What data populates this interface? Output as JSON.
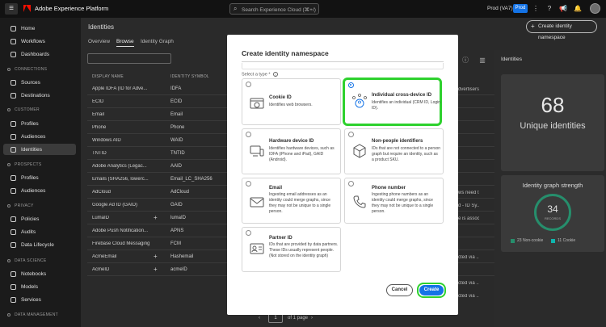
{
  "topbar": {
    "app_title": "Adobe Experience Platform",
    "search_placeholder": "Search Experience Cloud (⌘+/)",
    "org": "Prod (VA7)",
    "env_badge": "Prod"
  },
  "sidebar": {
    "items_top": [
      {
        "label": "Home",
        "icon": "home-icon"
      },
      {
        "label": "Workflows",
        "icon": "workflows-icon"
      },
      {
        "label": "Dashboards",
        "icon": "dashboards-icon"
      }
    ],
    "sections": [
      {
        "title": "CONNECTIONS",
        "items": [
          {
            "label": "Sources"
          },
          {
            "label": "Destinations"
          }
        ]
      },
      {
        "title": "CUSTOMER",
        "items": [
          {
            "label": "Profiles"
          },
          {
            "label": "Audiences"
          },
          {
            "label": "Identities"
          }
        ]
      },
      {
        "title": "PROSPECTS",
        "items": [
          {
            "label": "Profiles"
          },
          {
            "label": "Audiences"
          }
        ]
      },
      {
        "title": "PRIVACY",
        "items": [
          {
            "label": "Policies"
          },
          {
            "label": "Audits"
          },
          {
            "label": "Data Lifecycle"
          }
        ]
      },
      {
        "title": "DATA SCIENCE",
        "items": [
          {
            "label": "Notebooks"
          },
          {
            "label": "Models"
          },
          {
            "label": "Services"
          }
        ]
      },
      {
        "title": "DATA MANAGEMENT",
        "items": []
      }
    ]
  },
  "main": {
    "title": "Identities",
    "create_button": "Create identity namespace",
    "tabs": [
      "Overview",
      "Browse",
      "Identity Graph"
    ],
    "columns": [
      "DISPLAY NAME",
      "IDENTITY SYMBOL"
    ],
    "rows": [
      {
        "name": "Apple IDFA (ID for Adve...",
        "symbol": "IDFA",
        "plus": ""
      },
      {
        "name": "ECID",
        "symbol": "ECID",
        "plus": ""
      },
      {
        "name": "Email",
        "symbol": "Email",
        "plus": ""
      },
      {
        "name": "Phone",
        "symbol": "Phone",
        "plus": ""
      },
      {
        "name": "Windows AID",
        "symbol": "WAID",
        "plus": ""
      },
      {
        "name": "TNTID",
        "symbol": "TNTID",
        "plus": ""
      },
      {
        "name": "Adobe Analytics (Legac...",
        "symbol": "AAID",
        "plus": ""
      },
      {
        "name": "Emails (SHA256, lowerc...",
        "symbol": "Email_LC_SHA256",
        "plus": ""
      },
      {
        "name": "AdCloud",
        "symbol": "AdCloud",
        "plus": ""
      },
      {
        "name": "Google Ad ID (GAID)",
        "symbol": "GAID",
        "plus": ""
      },
      {
        "name": "LumaID",
        "symbol": "lumaID",
        "plus": "+"
      },
      {
        "name": "Adobe Push Notification...",
        "symbol": "APNS",
        "plus": ""
      },
      {
        "name": "Firebase Cloud Messaging",
        "symbol": "FCM",
        "plus": ""
      },
      {
        "name": "AcmeEmail",
        "symbol": "Hashemail",
        "plus": "+"
      },
      {
        "name": "AcmeID",
        "symbol": "acmeID",
        "plus": "+"
      }
    ],
    "right_column_fragments": [
      "dvertisers...",
      "ws need t...",
      "d - ID Sy...",
      "e is assoc...",
      "cted via ...",
      "cted via ...",
      "cted via ..."
    ],
    "pager": {
      "page": "1",
      "of_text": "of 1 page"
    }
  },
  "right_panel": {
    "title": "Identities",
    "count": "68",
    "count_label": "Unique identities",
    "strength_title": "Identity graph strength",
    "records": "34",
    "records_label": "RECORDS",
    "legend": [
      {
        "label": "23 Non-cookie",
        "color": "#268e6c"
      },
      {
        "label": "11 Cookie",
        "color": "#0fb5ae"
      }
    ]
  },
  "modal": {
    "title": "Create identity namespace",
    "select_label": "Select a type",
    "required_mark": "*",
    "options": [
      {
        "title": "Cookie ID",
        "desc": "Identifies web browsers.",
        "selected": false,
        "icon": "cookie-icon"
      },
      {
        "title": "Individual cross-device ID",
        "desc": "Identifies an individual (CRM ID, Login ID).",
        "selected": true,
        "icon": "person-network-icon"
      },
      {
        "title": "Hardware device ID",
        "desc": "Identifies hardware devices, such as IDFA (iPhone and iPad), GAID (Android).",
        "selected": false,
        "icon": "devices-icon"
      },
      {
        "title": "Non-people identifiers",
        "desc": "IDs that are not connected to a person graph but require an identity, such as a product SKU.",
        "selected": false,
        "icon": "box-icon"
      },
      {
        "title": "Email",
        "desc": "Ingesting email addresses as an identity could merge graphs, since they may not be unique to a single person.",
        "selected": false,
        "icon": "email-icon"
      },
      {
        "title": "Phone number",
        "desc": "Ingesting phone numbers as an identity could merge graphs, since they may not be unique to a single person.",
        "selected": false,
        "icon": "phone-icon"
      },
      {
        "title": "Partner ID",
        "desc": "IDs that are provided by data partners. These IDs usually represent people. (Not stored on the identity graph)",
        "selected": false,
        "icon": "partner-icon"
      }
    ],
    "cancel": "Cancel",
    "create": "Create"
  },
  "colors": {
    "accent": "#1473e6",
    "highlight": "#2ed12e",
    "brand_red": "#fa0f00"
  }
}
